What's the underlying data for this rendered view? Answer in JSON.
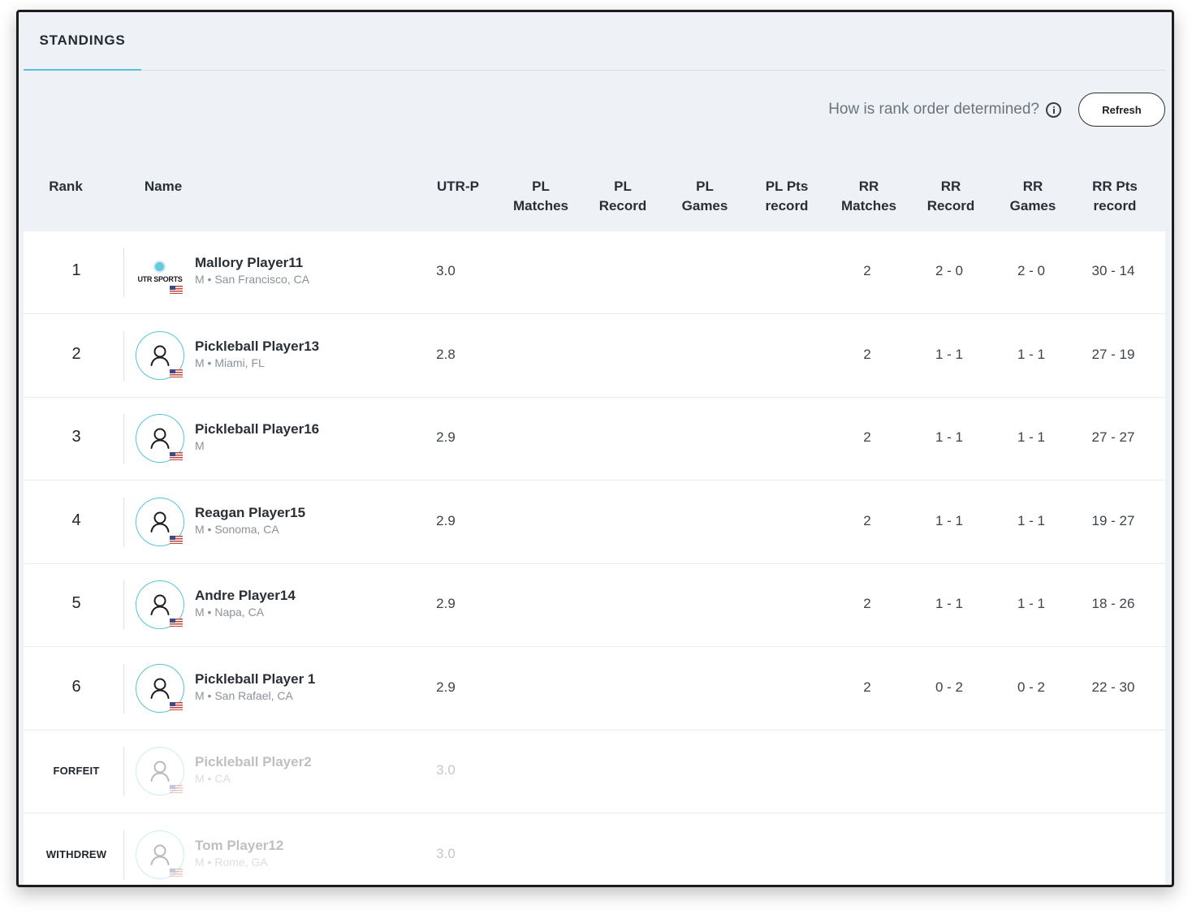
{
  "tabs": [
    {
      "label": "STANDINGS"
    }
  ],
  "toolbar": {
    "rank_help": "How is rank order determined?",
    "refresh_label": "Refresh"
  },
  "columns": {
    "rank": "Rank",
    "name": "Name",
    "utr_p": "UTR-P",
    "pl_matches": [
      "PL",
      "Matches"
    ],
    "pl_record": [
      "PL",
      "Record"
    ],
    "pl_games": [
      "PL",
      "Games"
    ],
    "pl_pts": [
      "PL Pts",
      "record"
    ],
    "rr_matches": [
      "RR",
      "Matches"
    ],
    "rr_record": [
      "RR",
      "Record"
    ],
    "rr_games": [
      "RR",
      "Games"
    ],
    "rr_pts": [
      "RR Pts",
      "record"
    ]
  },
  "logo_text": "UTR SPORTS",
  "rows": [
    {
      "rank": "1",
      "name": "Mallory Player11",
      "detail": "M • San Francisco, CA",
      "utr": "3.0",
      "pl_matches": "",
      "pl_record": "",
      "pl_games": "",
      "pl_pts": "",
      "rr_matches": "2",
      "rr_record": "2 - 0",
      "rr_games": "2 - 0",
      "rr_pts": "30 - 14",
      "avatar": "utr-sports-logo"
    },
    {
      "rank": "2",
      "name": "Pickleball Player13",
      "detail": "M • Miami, FL",
      "utr": "2.8",
      "pl_matches": "",
      "pl_record": "",
      "pl_games": "",
      "pl_pts": "",
      "rr_matches": "2",
      "rr_record": "1 - 1",
      "rr_games": "1 - 1",
      "rr_pts": "27 - 19",
      "avatar": "user-icon"
    },
    {
      "rank": "3",
      "name": "Pickleball Player16",
      "detail": "M",
      "utr": "2.9",
      "pl_matches": "",
      "pl_record": "",
      "pl_games": "",
      "pl_pts": "",
      "rr_matches": "2",
      "rr_record": "1 - 1",
      "rr_games": "1 - 1",
      "rr_pts": "27 - 27",
      "avatar": "user-icon"
    },
    {
      "rank": "4",
      "name": "Reagan Player15",
      "detail": "M • Sonoma, CA",
      "utr": "2.9",
      "pl_matches": "",
      "pl_record": "",
      "pl_games": "",
      "pl_pts": "",
      "rr_matches": "2",
      "rr_record": "1 - 1",
      "rr_games": "1 - 1",
      "rr_pts": "19 - 27",
      "avatar": "user-icon"
    },
    {
      "rank": "5",
      "name": "Andre Player14",
      "detail": "M • Napa, CA",
      "utr": "2.9",
      "pl_matches": "",
      "pl_record": "",
      "pl_games": "",
      "pl_pts": "",
      "rr_matches": "2",
      "rr_record": "1 - 1",
      "rr_games": "1 - 1",
      "rr_pts": "18 - 26",
      "avatar": "user-icon"
    },
    {
      "rank": "6",
      "name": "Pickleball Player 1",
      "detail": "M • San Rafael, CA",
      "utr": "2.9",
      "pl_matches": "",
      "pl_record": "",
      "pl_games": "",
      "pl_pts": "",
      "rr_matches": "2",
      "rr_record": "0 - 2",
      "rr_games": "0 - 2",
      "rr_pts": "22 - 30",
      "avatar": "user-icon"
    },
    {
      "rank": "FORFEIT",
      "name": "Pickleball Player2",
      "detail": "M • CA",
      "utr": "3.0",
      "pl_matches": "",
      "pl_record": "",
      "pl_games": "",
      "pl_pts": "",
      "rr_matches": "",
      "rr_record": "",
      "rr_games": "",
      "rr_pts": "",
      "avatar": "user-icon"
    },
    {
      "rank": "WITHDREW",
      "name": "Tom Player12",
      "detail": "M • Rome, GA",
      "utr": "3.0",
      "pl_matches": "",
      "pl_record": "",
      "pl_games": "",
      "pl_pts": "",
      "rr_matches": "",
      "rr_record": "",
      "rr_games": "",
      "rr_pts": "",
      "avatar": "user-icon"
    }
  ],
  "colors": {
    "accent": "#57c2d6",
    "header_bg": "#eef2f6",
    "row_bg": "#ffffff"
  }
}
